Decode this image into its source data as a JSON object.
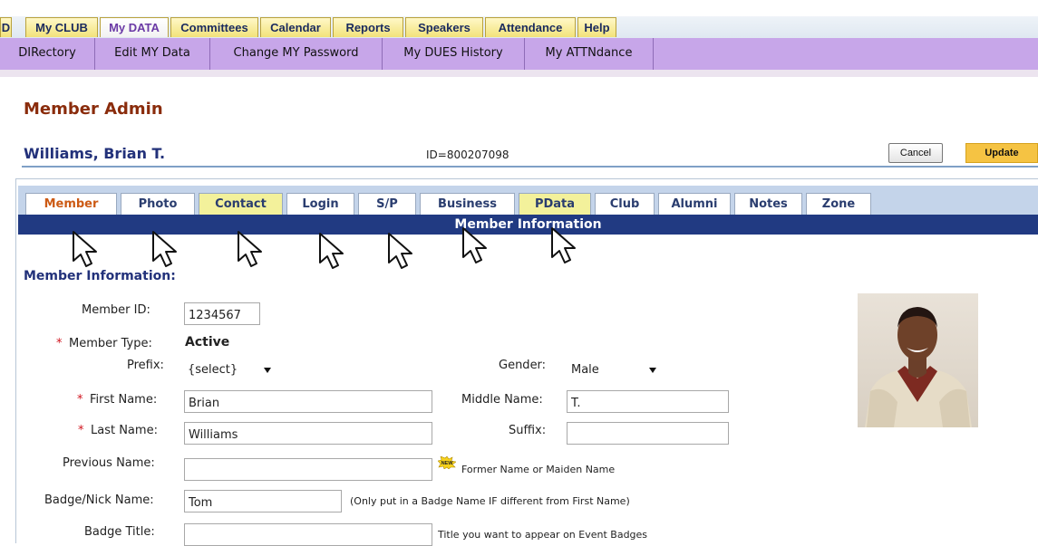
{
  "top_tabs": {
    "items": [
      {
        "label": "D"
      },
      {
        "label": "My CLUB"
      },
      {
        "label": "My DATA",
        "active": true
      },
      {
        "label": "Committees"
      },
      {
        "label": "Calendar"
      },
      {
        "label": "Reports"
      },
      {
        "label": "Speakers"
      },
      {
        "label": "Attendance"
      },
      {
        "label": "Help"
      }
    ]
  },
  "sub_menu": {
    "items": [
      {
        "label": "DIRectory"
      },
      {
        "label": "Edit MY Data"
      },
      {
        "label": "Change MY Password"
      },
      {
        "label": "My DUES History"
      },
      {
        "label": "My ATTNdance"
      }
    ]
  },
  "page": {
    "title": "Member Admin",
    "member_name": "Williams, Brian T.",
    "id_line": "ID=800207098",
    "cancel_label": "Cancel",
    "update_label": "Update"
  },
  "inner_tabs": {
    "items": [
      {
        "label": "Member",
        "active": true
      },
      {
        "label": "Photo"
      },
      {
        "label": "Contact",
        "highlighted": true
      },
      {
        "label": "Login"
      },
      {
        "label": "S/P"
      },
      {
        "label": "Business"
      },
      {
        "label": "PData",
        "highlighted": true
      },
      {
        "label": "Club"
      },
      {
        "label": "Alumni"
      },
      {
        "label": "Notes"
      },
      {
        "label": "Zone"
      }
    ],
    "strip_title": "Member Information"
  },
  "form": {
    "section_heading": "Member Information:",
    "required_mark": "*",
    "member_id": {
      "label": "Member ID:",
      "value": "1234567"
    },
    "member_type": {
      "label": "Member Type:",
      "value": "Active"
    },
    "prefix": {
      "label": "Prefix:",
      "value": "{select}"
    },
    "gender": {
      "label": "Gender:",
      "value": "Male"
    },
    "first_name": {
      "label": "First Name:",
      "value": "Brian"
    },
    "middle_name": {
      "label": "Middle Name:",
      "value": "T."
    },
    "last_name": {
      "label": "Last Name:",
      "value": "Williams"
    },
    "suffix": {
      "label": "Suffix:",
      "value": ""
    },
    "previous_name": {
      "label": "Previous Name:",
      "value": "",
      "note": "Former Name or Maiden Name",
      "badge": "NEW"
    },
    "badge_nick_name": {
      "label": "Badge/Nick Name:",
      "value": "Tom",
      "note": "(Only put in a Badge Name IF different from First Name)"
    },
    "badge_title": {
      "label": "Badge Title:",
      "value": "",
      "note": "Title you want to appear on Event Badges"
    }
  },
  "colors": {
    "accent_title": "#8a2c0c",
    "member_name": "#22317a",
    "strip": "#213a82",
    "sub_menu": "#c7a6e9",
    "update_button": "#f5c343",
    "required": "#d0131d"
  }
}
